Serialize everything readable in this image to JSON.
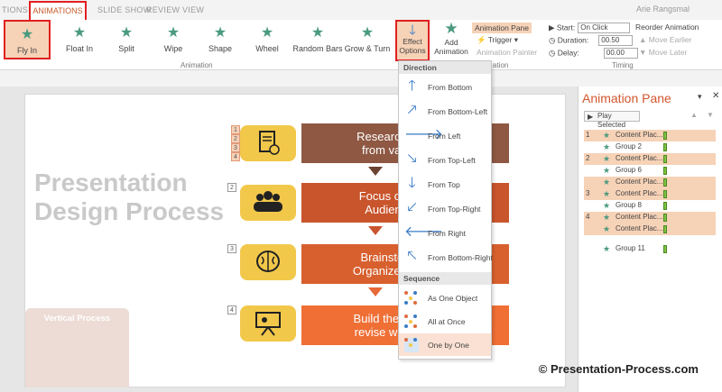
{
  "tabs": {
    "items": [
      "TIONS",
      "ANIMATIONS",
      "SLIDE SHOW",
      "REVIEW",
      "VIEW"
    ],
    "user": "Arie Rangsmal"
  },
  "ribbon": {
    "effects": [
      "Fly In",
      "Float In",
      "Split",
      "Wipe",
      "Shape",
      "Wheel",
      "Random Bars",
      "Grow & Turn"
    ],
    "group_animation": "Animation",
    "effect_options": {
      "line1": "Effect",
      "line2": "Options"
    },
    "add_animation": {
      "line1": "Add",
      "line2": "Animation"
    },
    "animation_pane": "Animation Pane",
    "trigger": "Trigger",
    "animation_painter": "Animation Painter",
    "group_animation2": "ation",
    "start_label": "Start:",
    "start_value": "On Click",
    "duration_label": "Duration:",
    "duration_value": "00.50",
    "delay_label": "Delay:",
    "delay_value": "00.00",
    "reorder": "Reorder Animation",
    "move_earlier": "Move Earlier",
    "move_later": "Move Later",
    "group_timing": "Timing"
  },
  "slide": {
    "title_line1": "Presentation",
    "title_line2": "Design Process",
    "vertical_process": "Vertical Process",
    "steps": [
      {
        "num": "1",
        "line1": "Research & Collec",
        "line2": "from various sou",
        "color": "#8e5843"
      },
      {
        "num": "2",
        "line1": "Focus on audienc",
        "line2": "Audience-Need",
        "color": "#c9552c"
      },
      {
        "num": "3",
        "line1": "Brainstorm, gene",
        "line2": "Organize Ideas as o",
        "color": "#d8602e"
      },
      {
        "num": "4",
        "line1": "Build the basic slide",
        "line2": "revise with compelli",
        "color": "#ef6f35"
      }
    ],
    "tags_first": [
      "1",
      "2",
      "3",
      "4"
    ]
  },
  "menu": {
    "direction_header": "Direction",
    "directions": [
      {
        "label": "From Bottom",
        "icon": "arrow-up-icon",
        "glyph": "🡑"
      },
      {
        "label": "From Bottom-Left",
        "icon": "arrow-up-right-icon",
        "glyph": "🡕"
      },
      {
        "label": "From Left",
        "icon": "arrow-right-icon",
        "glyph": "🡒"
      },
      {
        "label": "From Top-Left",
        "icon": "arrow-down-right-icon",
        "glyph": "🡖"
      },
      {
        "label": "From Top",
        "icon": "arrow-down-icon",
        "glyph": "🡓"
      },
      {
        "label": "From Top-Right",
        "icon": "arrow-down-left-icon",
        "glyph": "🡗"
      },
      {
        "label": "From Right",
        "icon": "arrow-left-icon",
        "glyph": "🡐"
      },
      {
        "label": "From Bottom-Right",
        "icon": "arrow-up-left-icon",
        "glyph": "🡔"
      }
    ],
    "sequence_header": "Sequence",
    "sequences": [
      "As One Object",
      "All at Once",
      "One by One"
    ]
  },
  "pane": {
    "title": "Animation Pane",
    "play_selected": "Play Selected",
    "rows": [
      {
        "n": "1",
        "label": "Content Plac...",
        "hot": true
      },
      {
        "n": "",
        "label": "Group 2",
        "hot": false
      },
      {
        "n": "2",
        "label": "Content Plac...",
        "hot": true
      },
      {
        "n": "",
        "label": "Group 6",
        "hot": false
      },
      {
        "n": "",
        "label": "Content Plac...",
        "hot": true
      },
      {
        "n": "3",
        "label": "Content Plac...",
        "hot": true
      },
      {
        "n": "",
        "label": "Group 8",
        "hot": false
      },
      {
        "n": "4",
        "label": "Content Plac...",
        "hot": true
      },
      {
        "n": "",
        "label": "Content Plac...",
        "hot": true
      },
      {
        "n": "",
        "label": "Group 11",
        "hot": false
      }
    ]
  },
  "credit": "© Presentation-Process.com",
  "colors": {
    "accent": "#d2562d",
    "selected_fill": "#f6d2b7",
    "red_outline": "#e02020"
  }
}
